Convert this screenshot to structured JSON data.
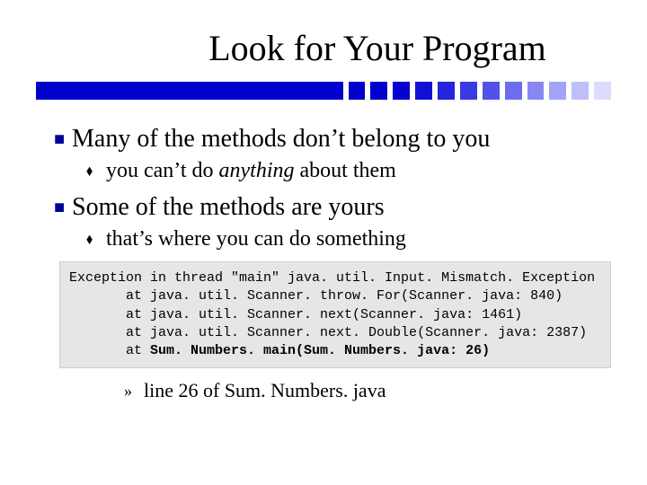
{
  "title": "Look for Your Program",
  "stripe": {
    "blocks": [
      "#0000cc",
      "#0000cc",
      "#0404d1",
      "#1111d6",
      "#2525dc",
      "#3a3ae2",
      "#5252e8",
      "#6c6cee",
      "#8787f3",
      "#a3a3f7",
      "#bfbffb",
      "#dcdcfe"
    ]
  },
  "bullets": {
    "l1a": "Many of the methods don’t belong to you",
    "l2a_pre": "you can’t do ",
    "l2a_italic": "anything",
    "l2a_post": " about them",
    "l1b": "Some of the methods are yours",
    "l2b": "that’s where you can do something",
    "code_line1": "Exception in thread \"main\" java. util. Input. Mismatch. Exception",
    "code_line2": "       at java. util. Scanner. throw. For(Scanner. java: 840)",
    "code_line3": "       at java. util. Scanner. next(Scanner. java: 1461)",
    "code_line4": "       at java. util. Scanner. next. Double(Scanner. java: 2387)",
    "code_line5_prefix": "       at ",
    "code_line5_bold": "Sum. Numbers. main(Sum. Numbers. java: 26)",
    "l3": "line 26 of Sum. Numbers. java"
  },
  "markers": {
    "l1": "■",
    "l2": "⬧",
    "l3": "»"
  }
}
